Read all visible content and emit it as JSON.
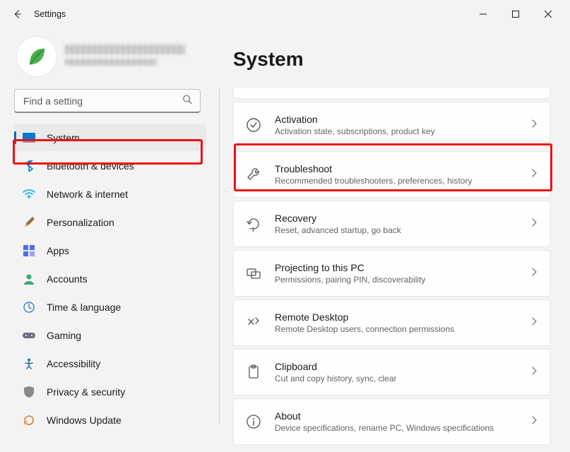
{
  "window": {
    "title": "Settings"
  },
  "search": {
    "placeholder": "Find a setting"
  },
  "nav": {
    "items": [
      {
        "label": "System"
      },
      {
        "label": "Bluetooth & devices"
      },
      {
        "label": "Network & internet"
      },
      {
        "label": "Personalization"
      },
      {
        "label": "Apps"
      },
      {
        "label": "Accounts"
      },
      {
        "label": "Time & language"
      },
      {
        "label": "Gaming"
      },
      {
        "label": "Accessibility"
      },
      {
        "label": "Privacy & security"
      },
      {
        "label": "Windows Update"
      }
    ]
  },
  "main": {
    "heading": "System",
    "cards": [
      {
        "title": "Activation",
        "sub": "Activation state, subscriptions, product key"
      },
      {
        "title": "Troubleshoot",
        "sub": "Recommended troubleshooters, preferences, history"
      },
      {
        "title": "Recovery",
        "sub": "Reset, advanced startup, go back"
      },
      {
        "title": "Projecting to this PC",
        "sub": "Permissions, pairing PIN, discoverability"
      },
      {
        "title": "Remote Desktop",
        "sub": "Remote Desktop users, connection permissions"
      },
      {
        "title": "Clipboard",
        "sub": "Cut and copy history, sync, clear"
      },
      {
        "title": "About",
        "sub": "Device specifications, rename PC, Windows specifications"
      }
    ]
  },
  "highlight": {
    "sidebar_index": 0,
    "card_index": 1
  }
}
